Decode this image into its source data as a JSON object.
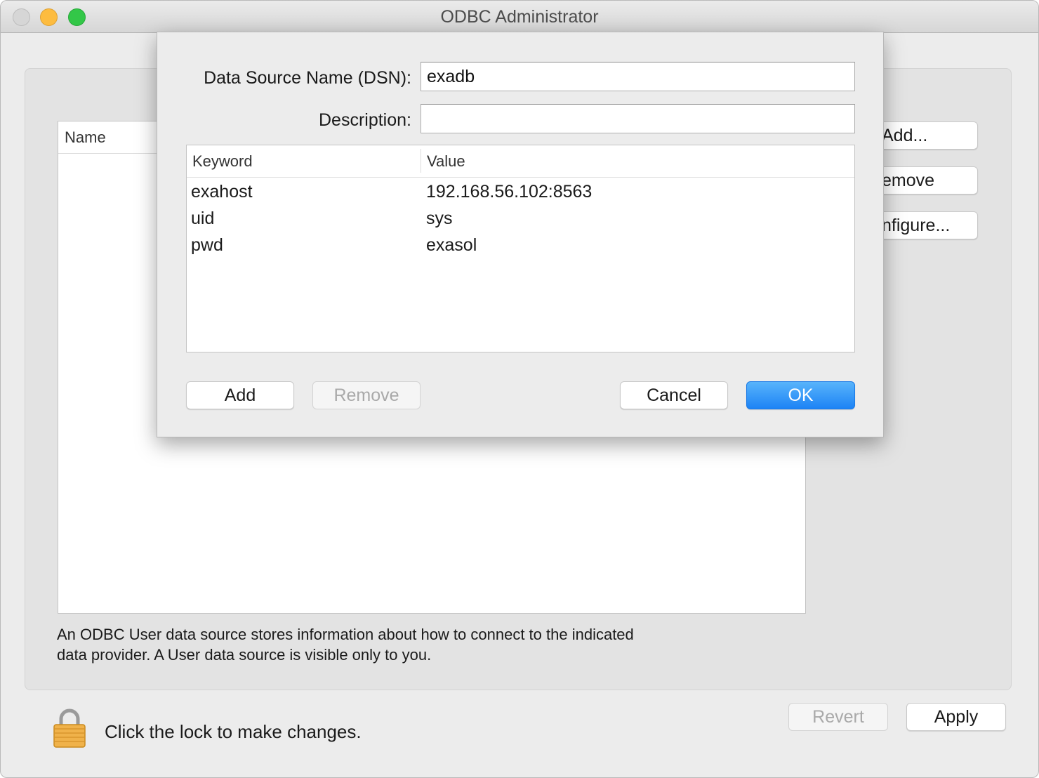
{
  "window": {
    "title": "ODBC Administrator"
  },
  "background": {
    "list_header": "Name",
    "buttons": {
      "add": "Add...",
      "remove": "emove",
      "configure": "nfigure..."
    },
    "info_text_line1": "An ODBC User data source stores information about how to connect to the indicated",
    "info_text_line2": "data provider. A User data source is visible only to you.",
    "lock_text": "Click the lock to make changes.",
    "revert_label": "Revert",
    "apply_label": "Apply"
  },
  "dialog": {
    "dsn_label": "Data Source Name (DSN):",
    "dsn_value": "exadb",
    "description_label": "Description:",
    "description_value": "",
    "table": {
      "columns": [
        "Keyword",
        "Value"
      ],
      "rows": [
        {
          "keyword": "exahost",
          "value": "192.168.56.102:8563"
        },
        {
          "keyword": "uid",
          "value": "sys"
        },
        {
          "keyword": "pwd",
          "value": "exasol"
        }
      ]
    },
    "buttons": {
      "add": "Add",
      "remove": "Remove",
      "cancel": "Cancel",
      "ok": "OK"
    }
  },
  "colors": {
    "accent": "#1d83f5",
    "lock": "#f0b24a"
  },
  "icons": {
    "lock": "lock-icon"
  }
}
